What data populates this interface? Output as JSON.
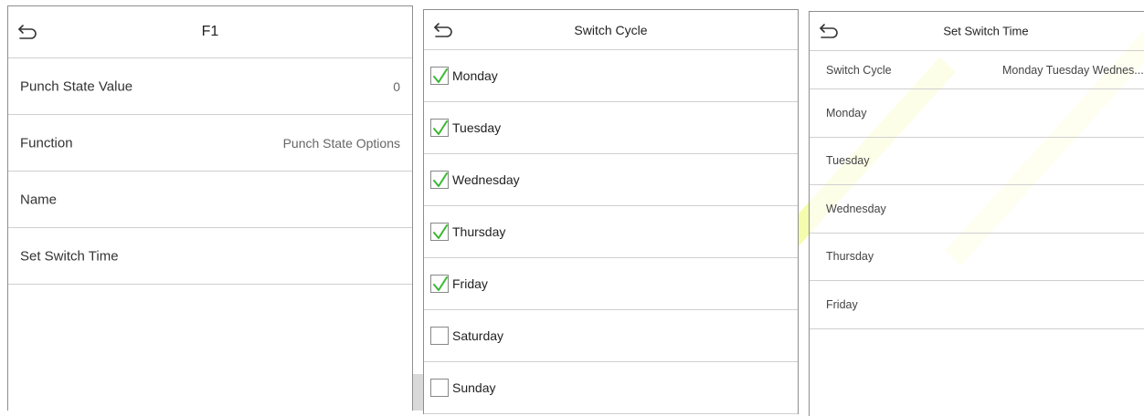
{
  "panel1": {
    "title": "F1",
    "rows": [
      {
        "label": "Punch State Value",
        "value": "0"
      },
      {
        "label": "Function",
        "value": "Punch State Options"
      },
      {
        "label": "Name",
        "value": ""
      },
      {
        "label": "Set Switch Time",
        "value": ""
      }
    ]
  },
  "panel2": {
    "title": "Switch Cycle",
    "days": [
      {
        "label": "Monday",
        "checked": true
      },
      {
        "label": "Tuesday",
        "checked": true
      },
      {
        "label": "Wednesday",
        "checked": true
      },
      {
        "label": "Thursday",
        "checked": true
      },
      {
        "label": "Friday",
        "checked": true
      },
      {
        "label": "Saturday",
        "checked": false
      },
      {
        "label": "Sunday",
        "checked": false
      }
    ]
  },
  "panel3": {
    "title": "Set Switch Time",
    "switch_cycle_label": "Switch Cycle",
    "switch_cycle_value": "Monday Tuesday Wednes...",
    "days": [
      "Monday",
      "Tuesday",
      "Wednesday",
      "Thursday",
      "Friday"
    ]
  },
  "colors": {
    "check": "#3cb832",
    "watermark": "#eef96a",
    "border": "#cfcfcf"
  },
  "icons": {
    "back": "back-arrow-icon",
    "check": "checkmark-icon"
  }
}
